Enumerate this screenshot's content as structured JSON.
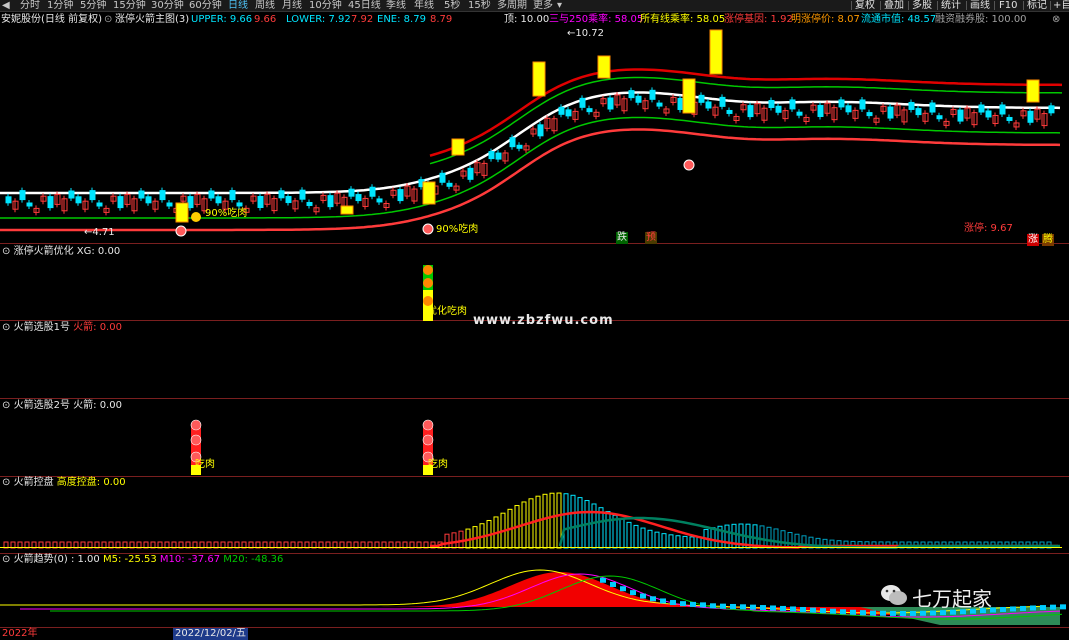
{
  "toolbar": {
    "intervals": [
      "分时",
      "1分钟",
      "5分钟",
      "15分钟",
      "30分钟",
      "60分钟",
      "日线",
      "周线",
      "月线",
      "10分钟",
      "45日线",
      "季线",
      "年线",
      "5秒",
      "15秒",
      "多周期",
      "更多"
    ],
    "active_interval": "日线",
    "right_buttons": [
      "复权",
      "叠加",
      "多股",
      "统计",
      "画线",
      "F10",
      "标记",
      "+自"
    ]
  },
  "main": {
    "stock_name": "安妮股份",
    "mode": "(日线 前复权)",
    "indicator_name": "涨停火箭主图(3)",
    "upper_label": "UPPER: 9.66",
    "upper_value2": "9.66",
    "lower_label": "LOWER: 7.92",
    "lower_value2": "7.92",
    "ene_label": "ENE: 8.79",
    "ene_value2": "8.79",
    "top_label": "顶: 10.00",
    "rate_250_label": "三与250乘率: 58.05",
    "all_rate_label": "所有线乘率: 58.05",
    "limit_label": "涨停基因: 1.92",
    "tomorrow_label": "明涨停价: 8.07",
    "float_cap_label": "流通市值: 48.57",
    "margin_label": "融资融券股: 100.00",
    "high_marker": "10.72",
    "low_marker": "4.71",
    "annot_1": "90%吃肉",
    "annot_2": "90%吃肉",
    "badge_die": "跌",
    "badge_yu": "预",
    "limit_up_label": "涨停: 9.67",
    "badge_zhang": "涨",
    "badge_teng": "腾"
  },
  "panels": {
    "p1": {
      "name": "涨停火箭优化",
      "value": "XG: 0.00",
      "annot": "优化吃肉"
    },
    "p2": {
      "name": "火箭选股1号",
      "value": "火箭: 0.00"
    },
    "p3": {
      "name": "火箭选股2号",
      "value": "火箭: 0.00",
      "annot_1": "吃肉",
      "annot_2": "吃肉"
    },
    "p4": {
      "name": "火箭控盘",
      "value": "高度控盘: 0.00"
    },
    "p5": {
      "name": "火箭趋势(0)",
      "value": ": 1.00",
      "m5": "M5: -25.53",
      "m10": "M10: -37.67",
      "m20": "M20: -48.36"
    }
  },
  "watermark": "www.zbzfwu.com",
  "brand": "七万起家",
  "date_axis": {
    "left": "2022年",
    "cursor": "2022/12/02/五"
  },
  "colors": {
    "up": "#ff3b3b",
    "down": "#00e5ff",
    "yellow": "#ffff00",
    "white": "#ffffff",
    "green": "#00c800",
    "magenta": "#ff00ff",
    "blue_active": "#4fc3f7"
  }
}
